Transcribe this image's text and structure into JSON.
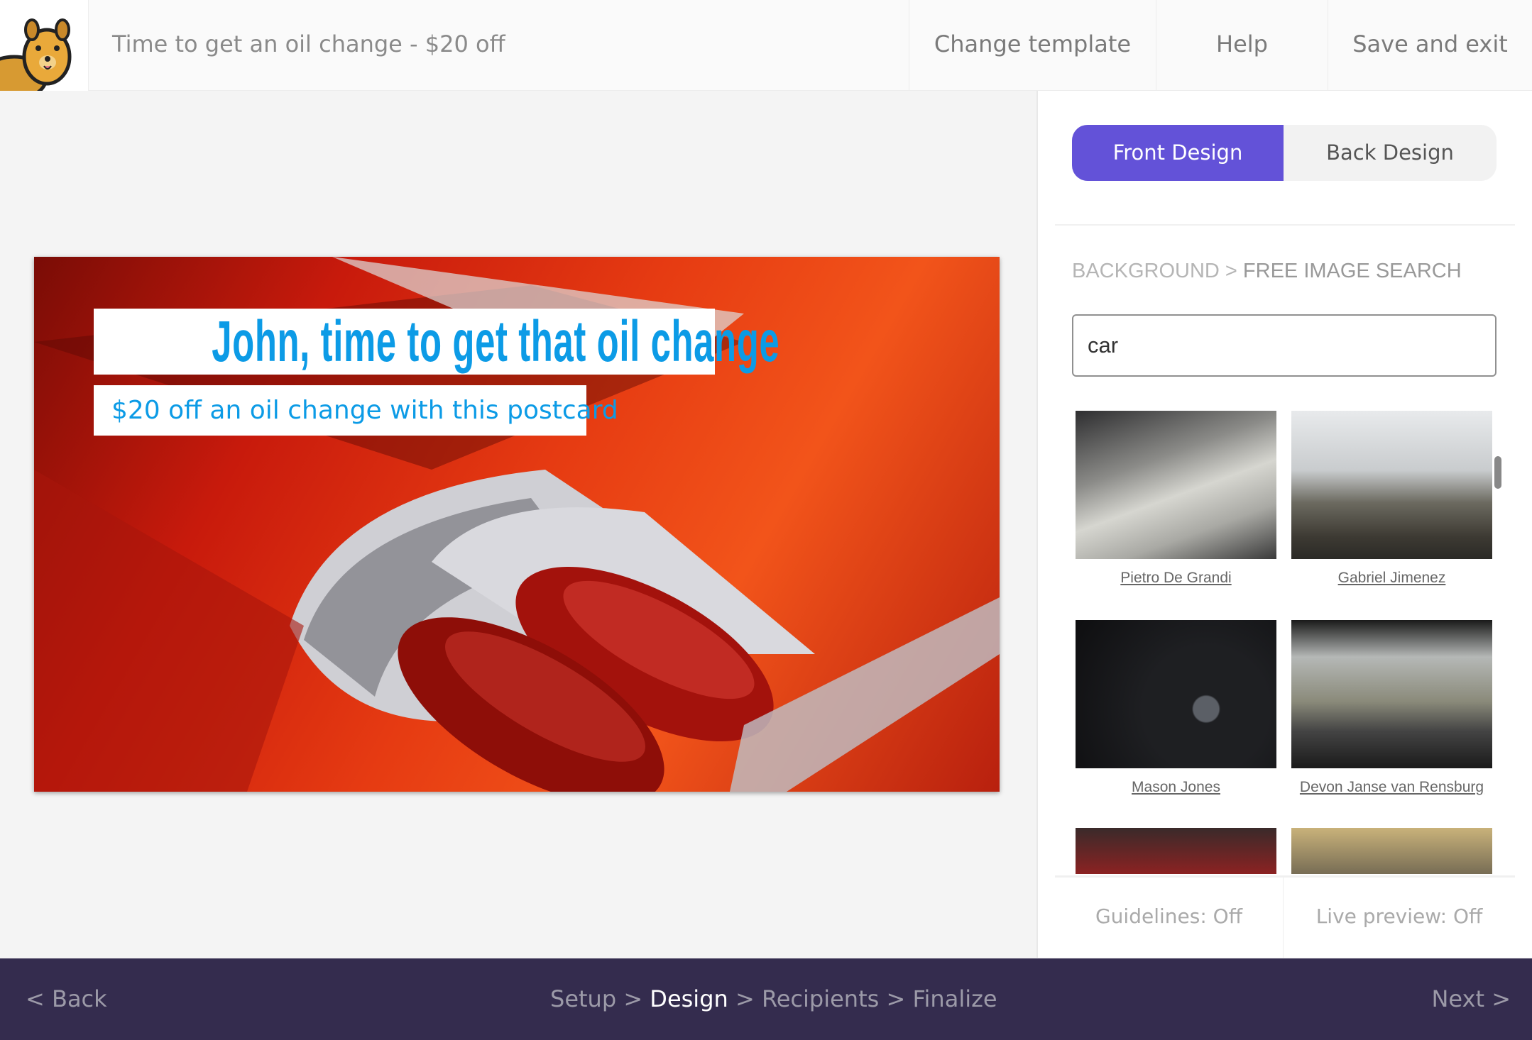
{
  "header": {
    "title": "Time to get an oil change - $20 off",
    "change_template": "Change template",
    "help": "Help",
    "save_exit": "Save and exit",
    "logo_icon": "quokka-mascot-icon"
  },
  "postcard": {
    "headline": "John, time to get that oil change",
    "subheadline": "$20 off an oil change with this postcard",
    "text_color": "#0c9be6"
  },
  "panel": {
    "tabs": [
      {
        "label": "Front Design",
        "active": true
      },
      {
        "label": "Back Design",
        "active": false
      }
    ],
    "breadcrumb": {
      "parent": "BACKGROUND",
      "separator": ">",
      "current": "FREE IMAGE SEARCH"
    },
    "search": {
      "value": "car"
    },
    "images": [
      {
        "credit": "Pietro De Grandi"
      },
      {
        "credit": "Gabriel Jimenez"
      },
      {
        "credit": "Mason Jones"
      },
      {
        "credit": "Devon Janse van Rensburg"
      },
      {
        "credit": ""
      },
      {
        "credit": ""
      }
    ],
    "guidelines": "Guidelines: Off",
    "live_preview": "Live preview: Off"
  },
  "footer": {
    "back": "Back",
    "next": "Next",
    "steps": [
      "Setup",
      "Design",
      "Recipients",
      "Finalize"
    ],
    "current_step": "Design"
  },
  "colors": {
    "accent": "#6352d8",
    "footer_bg": "#342c4e"
  }
}
